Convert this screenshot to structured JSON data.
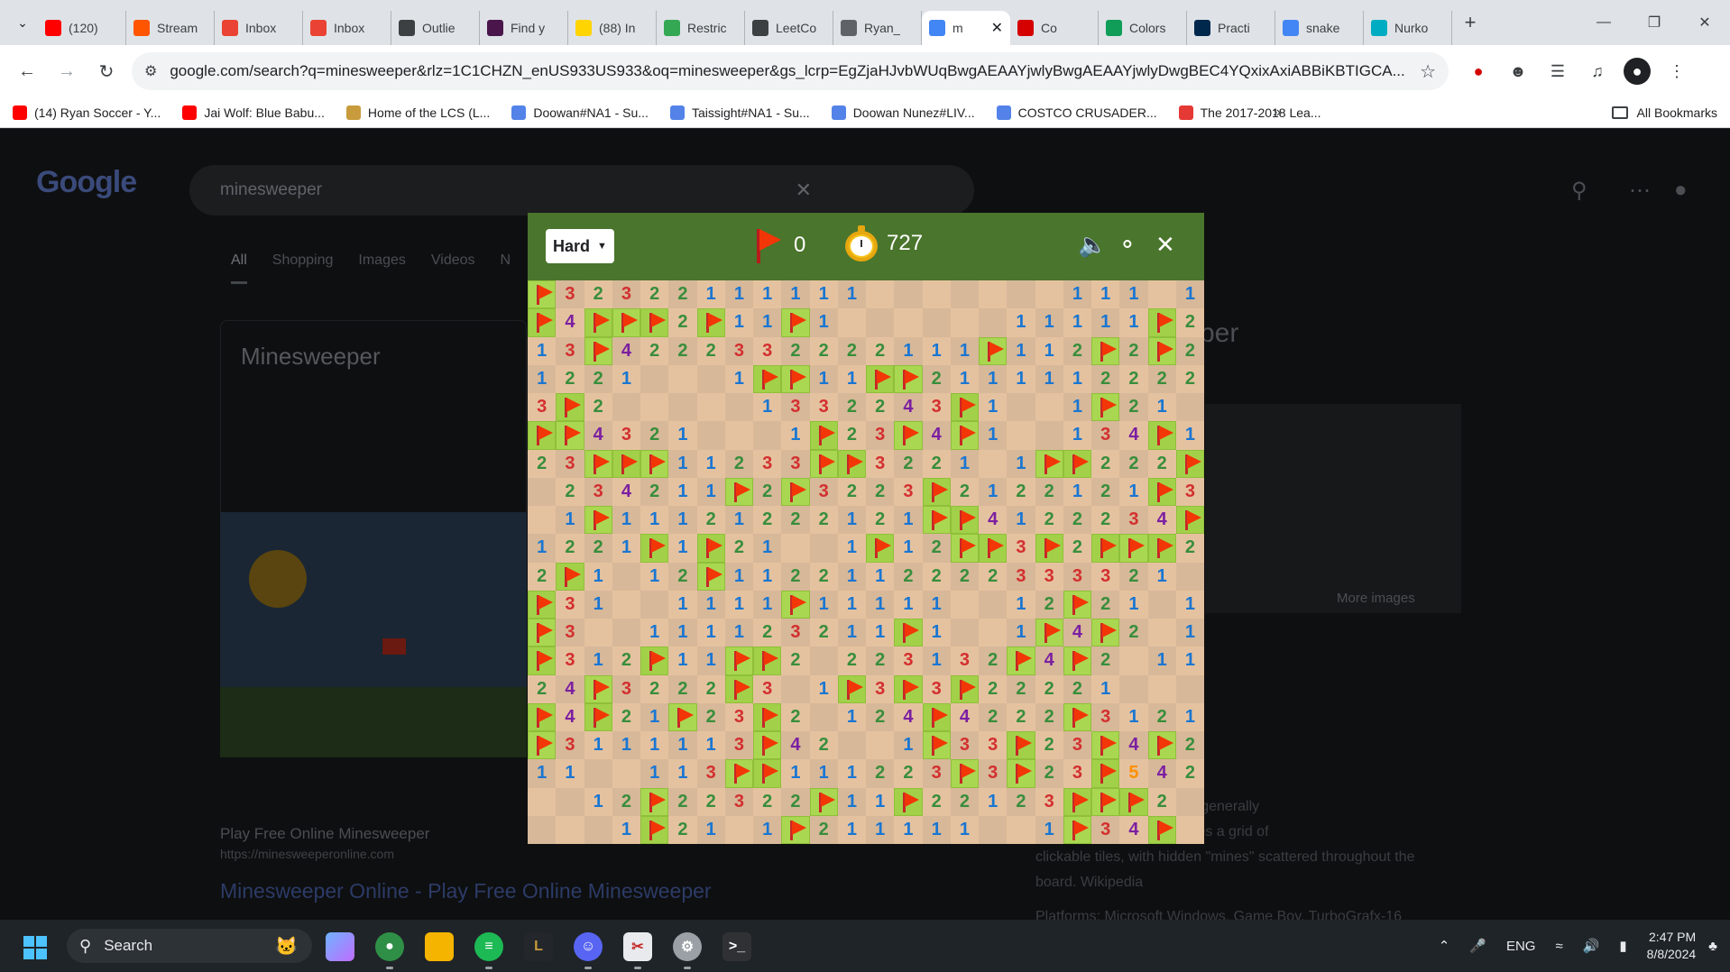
{
  "browser": {
    "tabs": [
      {
        "title": "(120)",
        "icon": "youtube-icon",
        "color": "#ff0000"
      },
      {
        "title": "Stream",
        "icon": "soundcloud-icon",
        "color": "#ff5500"
      },
      {
        "title": "Inbox",
        "icon": "gmail-icon",
        "color": "#ea4335"
      },
      {
        "title": "Inbox",
        "icon": "gmail-icon",
        "color": "#ea4335"
      },
      {
        "title": "Outlie",
        "icon": "outlier-icon",
        "color": "#3c4043"
      },
      {
        "title": "Find y",
        "icon": "slack-icon",
        "color": "#4a154b"
      },
      {
        "title": "(88) In",
        "icon": "h-icon",
        "color": "#ffd400"
      },
      {
        "title": "Restric",
        "icon": "leaf-icon",
        "color": "#34a853"
      },
      {
        "title": "LeetCo",
        "icon": "leetcode-icon",
        "color": "#3c4043"
      },
      {
        "title": "Ryan_",
        "icon": "globe-icon",
        "color": "#5f6368"
      },
      {
        "title": "m",
        "icon": "google-icon",
        "color": "#4285f4",
        "active": true
      },
      {
        "title": "Co",
        "icon": "red-circle-icon",
        "color": "#d50000"
      },
      {
        "title": "Colors",
        "icon": "w-icon",
        "color": "#0f9d58"
      },
      {
        "title": "Practi",
        "icon": "michigan-icon",
        "color": "#00274c"
      },
      {
        "title": "snake",
        "icon": "google-icon",
        "color": "#4285f4"
      },
      {
        "title": "Nurko",
        "icon": "nurko-icon",
        "color": "#00acc1"
      }
    ],
    "url": "google.com/search?q=minesweeper&rlz=1C1CHZN_enUS933US933&oq=minesweeper&gs_lcrp=EgZjaHJvbWUqBwgAEAAYjwlyBwgAEAAYjwlyDwgBEC4YQxixAxiABBiKBTIGCA...",
    "bookmarks": [
      {
        "label": "(14) Ryan Soccer - Y...",
        "color": "#ff0000"
      },
      {
        "label": "Jai Wolf: Blue Babu...",
        "color": "#ff0000"
      },
      {
        "label": "Home of the LCS (L...",
        "color": "#c89b3c"
      },
      {
        "label": "Doowan#NA1 - Su...",
        "color": "#5383e8"
      },
      {
        "label": "Taissight#NA1 - Su...",
        "color": "#5383e8"
      },
      {
        "label": "Doowan Nunez#LIV...",
        "color": "#5383e8"
      },
      {
        "label": "COSTCO CRUSADER...",
        "color": "#5383e8"
      },
      {
        "label": "The 2017-2018 Lea...",
        "color": "#e53935"
      }
    ],
    "bookmarks_more": "»",
    "all_bookmarks": "All Bookmarks"
  },
  "google": {
    "query": "minesweeper",
    "tabs": [
      "All",
      "Shopping",
      "Images",
      "Videos",
      "N"
    ],
    "panel_title": "Minesweeper",
    "right_title": "per",
    "more_images": "More images",
    "result_site": "Play Free Online Minesweeper",
    "result_url": "https://minesweeperonline.com",
    "result_heading": "Minesweeper Online - Play Free Online Minesweeper",
    "kp_text_1": "puzzle video game genre generally",
    "kp_text_2": "nputers. The game features a grid of",
    "kp_text_3": "clickable tiles, with hidden \"mines\" scattered throughout the",
    "kp_text_4": "board. Wikipedia",
    "kp_platforms": "Platforms: Microsoft Windows, Game Boy, TurboGrafx-16",
    "kp_ne": "ne"
  },
  "game": {
    "difficulty": "Hard",
    "flags_left": "0",
    "timer": "727",
    "board": [
      "F32322111111.......111.1F1",
      "F4FFF2F11F1......11111F2221",
      "13F4222332222111F112F2F21",
      "1221...1FF11FF211111222212F",
      "3F2.....1332243F1..1F21..11",
      "FF4321...1F23F4F1..134F1111",
      "23FFF11233FF3221.1FF222F1",
      ".234211F2F3223F2122121F31",
      ".1F11121222121FF4122234F2",
      "1221F1F21..1F12FF3F2FFF21",
      "2F1.12F1122112222333321..",
      "F31..1111F11111..12F21.111",
      "F3..111123211F1..1F4F2.1F1",
      "F312F11FF2.223132F4F2.111",
      "24F3222F3.1F3F3F22221.",
      "F4F21F23F2.124F4222F3121",
      "F3111113F42..1F33F23F4F2F",
      "11..113FF111223F3F23F542",
      "..12F22322F11F22123FFF2",
      "...1F21.1F211111..1F34F."
    ]
  },
  "taskbar": {
    "search_placeholder": "Search",
    "language": "ENG",
    "time": "2:47 PM",
    "date": "8/8/2024"
  }
}
